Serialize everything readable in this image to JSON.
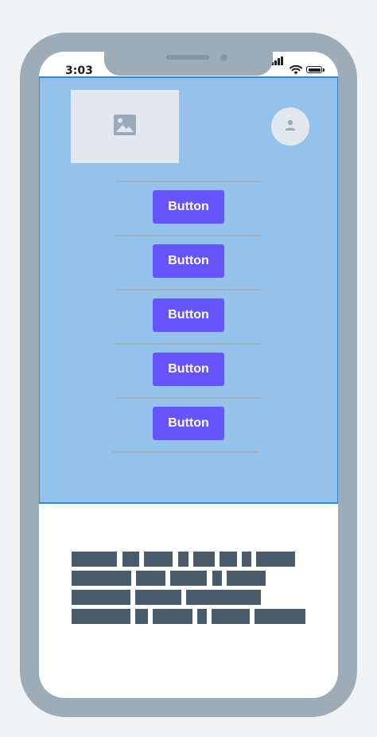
{
  "status_bar": {
    "time": "3:03"
  },
  "hero": {
    "buttons": [
      {
        "label": "Button"
      },
      {
        "label": "Button"
      },
      {
        "label": "Button"
      },
      {
        "label": "Button"
      },
      {
        "label": "Button"
      }
    ]
  },
  "colors": {
    "hero_background": "#95c2eb",
    "hero_border": "#2f86d5",
    "button": "#6554f9",
    "placeholder": "#e2e8f0",
    "text_block": "#4a5b69",
    "frame": "#9eacb7"
  },
  "icons": [
    "image-icon",
    "user-icon",
    "signal-icon",
    "wifi-icon",
    "battery-icon"
  ]
}
